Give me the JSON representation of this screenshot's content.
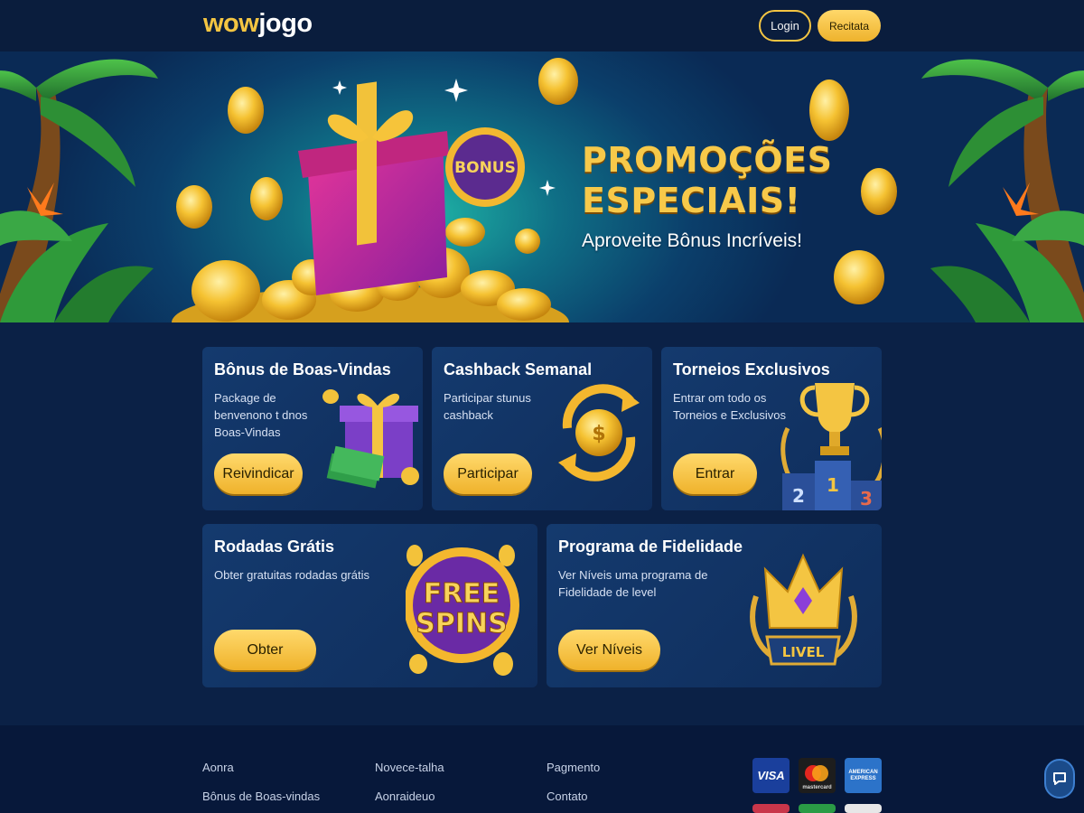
{
  "header": {
    "logo_part1": "wow",
    "logo_part2": "jogo",
    "login_label": "Login",
    "register_label": "Recitata"
  },
  "hero": {
    "title_line1": "PROMOÇÕES",
    "title_line2": "ESPECIAIS!",
    "subtitle": "Aproveite Bônus Incríveis!",
    "badge_text": "BONUS"
  },
  "cards": [
    {
      "title": "Bônus de Boas-Vindas",
      "desc_line1": "Package de",
      "desc_line2": "benvenono t dnos",
      "desc_line3": "Boas-Vindas",
      "button": "Reivindicar"
    },
    {
      "title": "Cashback Semanal",
      "desc_line1": "Participar stunus",
      "desc_line2": "cashback",
      "button": "Participar"
    },
    {
      "title": "Torneios Exclusivos",
      "desc_line1": "Entrar om todo os",
      "desc_line2": "Torneios e Exclusivos",
      "button": "Entrar",
      "podium": [
        "2",
        "1",
        "3"
      ]
    },
    {
      "title": "Rodadas Grátis",
      "desc_line1": "Obter gratuitas rodadas grátis",
      "button": "Obter",
      "art_line1": "FREE",
      "art_line2": "SPINS"
    },
    {
      "title": "Programa de Fidelidade",
      "desc_line1": "Ver Níveis uma programa de",
      "desc_line2": "Fidelidade de level",
      "button": "Ver Níveis",
      "badge": "LIVEL"
    }
  ],
  "footer": {
    "col1": [
      "Aonra",
      "Bônus de Boas-vindas"
    ],
    "col2": [
      "Novece-talha",
      "Aonraideuo"
    ],
    "col3": [
      "Pagmento",
      "Contato"
    ],
    "payments": [
      "VISA",
      "mastercard",
      "AMERICAN EXPRESS"
    ]
  },
  "colors": {
    "accent": "#f4c542",
    "background": "#0b2146",
    "card": "#143a6e"
  },
  "icons": [
    "chat-icon"
  ]
}
